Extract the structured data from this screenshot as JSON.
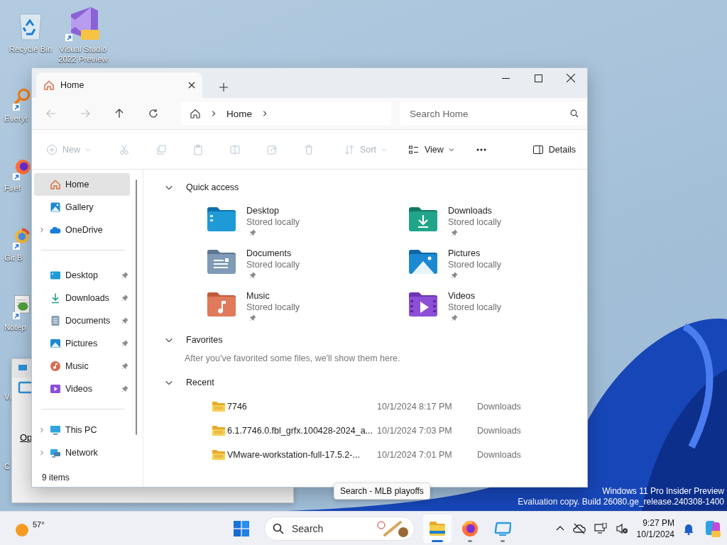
{
  "desktop": {
    "icons": [
      {
        "label": "Recycle Bin",
        "kind": "recycle"
      },
      {
        "label": "Visual Studio 2022 Preview",
        "kind": "vs"
      },
      {
        "label": "Everyt",
        "kind": "everything"
      },
      {
        "label": "Firef",
        "kind": "firefox"
      },
      {
        "label": "Git B",
        "kind": "git"
      },
      {
        "label": "Notep",
        "kind": "notepad"
      },
      {
        "label": "Vi",
        "kind": "hidden"
      },
      {
        "label": "C",
        "kind": "hidden"
      }
    ],
    "background_window": {
      "text": "Op"
    },
    "watermark": [
      "Windows 11 Pro Insider Preview",
      "Evaluation copy. Build 26080.ge_release.240308-1400"
    ],
    "tooltip": "Search - MLB playoffs"
  },
  "explorer": {
    "tabs": [
      {
        "label": "Home",
        "selected": true
      }
    ],
    "breadcrumb": [
      "Home"
    ],
    "search": {
      "placeholder": "Search Home"
    },
    "toolbar": [
      {
        "kind": "new",
        "label": "New",
        "disabled": true,
        "dropdown": true
      },
      {
        "kind": "cut",
        "disabled": true
      },
      {
        "kind": "copy",
        "disabled": true
      },
      {
        "kind": "paste",
        "disabled": true
      },
      {
        "kind": "rename",
        "disabled": true
      },
      {
        "kind": "share",
        "disabled": true
      },
      {
        "kind": "delete",
        "disabled": true
      },
      {
        "kind": "sort",
        "label": "Sort",
        "disabled": true,
        "dropdown": true
      },
      {
        "kind": "view",
        "label": "View",
        "disabled": false,
        "dropdown": true
      },
      {
        "kind": "more",
        "disabled": false
      },
      {
        "kind": "details",
        "label": "Details",
        "disabled": false
      }
    ],
    "sidebar": [
      {
        "items": [
          {
            "kind": "home",
            "label": "Home",
            "selected": true,
            "expandable": false,
            "pinned": false
          },
          {
            "kind": "gallery",
            "label": "Gallery",
            "selected": false,
            "expandable": false,
            "pinned": false
          },
          {
            "kind": "onedrive",
            "label": "OneDrive",
            "selected": false,
            "expandable": true,
            "pinned": false
          }
        ]
      },
      {
        "items": [
          {
            "kind": "desktop",
            "label": "Desktop",
            "selected": false,
            "expandable": false,
            "pinned": true
          },
          {
            "kind": "downloads",
            "label": "Downloads",
            "selected": false,
            "expandable": false,
            "pinned": true
          },
          {
            "kind": "documents",
            "label": "Documents",
            "selected": false,
            "expandable": false,
            "pinned": true
          },
          {
            "kind": "pictures",
            "label": "Pictures",
            "selected": false,
            "expandable": false,
            "pinned": true
          },
          {
            "kind": "music",
            "label": "Music",
            "selected": false,
            "expandable": false,
            "pinned": true
          },
          {
            "kind": "videos",
            "label": "Videos",
            "selected": false,
            "expandable": false,
            "pinned": true
          }
        ]
      },
      {
        "items": [
          {
            "kind": "thispc",
            "label": "This PC",
            "selected": false,
            "expandable": true,
            "pinned": false
          },
          {
            "kind": "network",
            "label": "Network",
            "selected": false,
            "expandable": true,
            "pinned": false
          }
        ]
      }
    ],
    "status": "9 items",
    "quick_access": {
      "title": "Quick access",
      "expanded": true,
      "items": [
        {
          "kind": "desktop",
          "name": "Desktop",
          "subtitle": "Stored locally",
          "pinned": true
        },
        {
          "kind": "downloads",
          "name": "Downloads",
          "subtitle": "Stored locally",
          "pinned": true
        },
        {
          "kind": "documents",
          "name": "Documents",
          "subtitle": "Stored locally",
          "pinned": true
        },
        {
          "kind": "pictures",
          "name": "Pictures",
          "subtitle": "Stored locally",
          "pinned": true
        },
        {
          "kind": "music",
          "name": "Music",
          "subtitle": "Stored locally",
          "pinned": true
        },
        {
          "kind": "videos",
          "name": "Videos",
          "subtitle": "Stored locally",
          "pinned": true
        }
      ]
    },
    "favorites": {
      "title": "Favorites",
      "expanded": true,
      "message": "After you've favorited some files, we'll show them here."
    },
    "recent": {
      "title": "Recent",
      "expanded": true,
      "rows": [
        {
          "name": "7746",
          "date": "10/1/2024 8:17 PM",
          "location": "Downloads"
        },
        {
          "name": "6.1.7746.0.fbl_grfx.100428-2024_a...",
          "date": "10/1/2024 7:03 PM",
          "location": "Downloads"
        },
        {
          "name": "VMware-workstation-full-17.5.2-...",
          "date": "10/1/2024 7:01 PM",
          "location": "Downloads"
        }
      ]
    }
  },
  "taskbar": {
    "weather": "57°",
    "search": {
      "placeholder": "Search"
    },
    "apps": [
      {
        "kind": "explorer",
        "active": true
      },
      {
        "kind": "firefox",
        "active": false
      },
      {
        "kind": "remote",
        "active": false
      }
    ],
    "time": "9:27 PM",
    "date": "10/1/2024"
  }
}
